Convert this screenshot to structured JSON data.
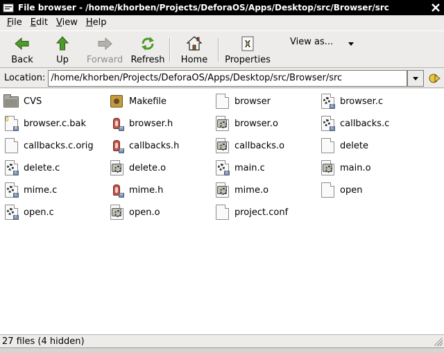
{
  "titlebar": {
    "title": "File browser - /home/khorben/Projects/DeforaOS/Apps/Desktop/src/Browser/src"
  },
  "menubar": {
    "items": [
      {
        "u": "F",
        "rest": "ile"
      },
      {
        "u": "E",
        "rest": "dit"
      },
      {
        "u": "V",
        "rest": "iew"
      },
      {
        "u": "H",
        "rest": "elp"
      }
    ]
  },
  "toolbar": {
    "back": "Back",
    "up": "Up",
    "forward": "Forward",
    "refresh": "Refresh",
    "home": "Home",
    "properties": "Properties",
    "view_as": "View as..."
  },
  "location": {
    "label": "Location:",
    "value": "/home/khorben/Projects/DeforaOS/Apps/Desktop/src/Browser/src"
  },
  "files": [
    {
      "name": "CVS",
      "icon": "folder-icon"
    },
    {
      "name": "Makefile",
      "icon": "makefile-icon"
    },
    {
      "name": "browser",
      "icon": "file-icon"
    },
    {
      "name": "browser.c",
      "icon": "c-source-icon"
    },
    {
      "name": "browser.c.bak",
      "icon": "backup-file-icon"
    },
    {
      "name": "browser.h",
      "icon": "c-header-icon"
    },
    {
      "name": "browser.o",
      "icon": "object-file-icon"
    },
    {
      "name": "callbacks.c",
      "icon": "c-source-icon"
    },
    {
      "name": "callbacks.c.orig",
      "icon": "file-icon"
    },
    {
      "name": "callbacks.h",
      "icon": "c-header-icon"
    },
    {
      "name": "callbacks.o",
      "icon": "object-file-icon"
    },
    {
      "name": "delete",
      "icon": "file-icon"
    },
    {
      "name": "delete.c",
      "icon": "c-source-icon"
    },
    {
      "name": "delete.o",
      "icon": "object-file-icon"
    },
    {
      "name": "main.c",
      "icon": "c-source-icon"
    },
    {
      "name": "main.o",
      "icon": "object-file-icon"
    },
    {
      "name": "mime.c",
      "icon": "c-source-icon"
    },
    {
      "name": "mime.h",
      "icon": "c-header-icon"
    },
    {
      "name": "mime.o",
      "icon": "object-file-icon"
    },
    {
      "name": "open",
      "icon": "file-icon"
    },
    {
      "name": "open.c",
      "icon": "c-source-icon"
    },
    {
      "name": "open.o",
      "icon": "object-file-icon"
    },
    {
      "name": "project.conf",
      "icon": "file-icon"
    }
  ],
  "status": {
    "text": "27 files (4 hidden)"
  },
  "colors": {
    "window_bg": "#edeceb",
    "titlebar_bg": "#000000",
    "content_bg": "#ffffff"
  }
}
